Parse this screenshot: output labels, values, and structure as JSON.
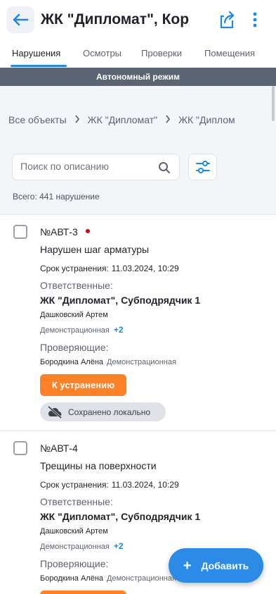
{
  "header": {
    "title": "ЖК \"Дипломат\", Кор",
    "back_icon": "arrow-left-icon",
    "share_icon": "share-icon",
    "more_icon": "more-vertical-icon"
  },
  "tabs": [
    {
      "label": "Нарушения",
      "active": true
    },
    {
      "label": "Осмотры",
      "active": false
    },
    {
      "label": "Проверки",
      "active": false
    },
    {
      "label": "Помещения",
      "active": false
    }
  ],
  "offline_banner": "Автономный режим",
  "breadcrumb": [
    "Все объекты",
    "ЖК \"Дипломат\"",
    "ЖК \"Диплом"
  ],
  "search": {
    "placeholder": "Поиск по описанию",
    "value": ""
  },
  "total": "Всего: 441 нарушение",
  "cards": [
    {
      "number": "№АВТ-3",
      "new_dot": true,
      "description": "Нарушен шаг арматуры",
      "due_label": "Срок устранения:",
      "due_value": "11.03.2024, 10:29",
      "responsible_label": "Ответственные:",
      "company": "ЖК \"Дипломат\", Субподрядчик 1",
      "person": "Дашковский Артем",
      "org": "Демонстрационная",
      "more": "+2",
      "inspectors_label": "Проверяющие:",
      "inspector": "Бородкина Алёна",
      "inspector_org": "Демонстрационная",
      "status": "К устранению",
      "saved": "Сохранено локально"
    },
    {
      "number": "№АВТ-4",
      "new_dot": false,
      "description": "Трещины на поверхности",
      "due_label": "Срок устранения:",
      "due_value": "11.03.2024, 10:29",
      "responsible_label": "Ответственные:",
      "company": "ЖК \"Дипломат\", Субподрядчик 1",
      "person": "Дашковский Артем",
      "org": "Демонстрационная",
      "more": "+2",
      "inspectors_label": "Проверяющие:",
      "inspector": "Бородкина Алёна",
      "inspector_org": "Демонстрационная"
    }
  ],
  "fab": {
    "label": "Добавить",
    "icon": "plus-icon"
  },
  "colors": {
    "accent": "#1e88e5",
    "status_orange": "#ff8126",
    "offline_bar": "#5a6472",
    "new_dot": "#d0021b"
  }
}
